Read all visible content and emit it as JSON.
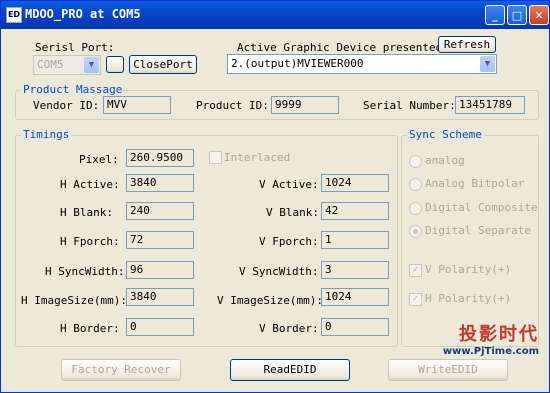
{
  "window": {
    "title": "MDOO_PRO at COM5",
    "icon_text": "ED"
  },
  "serial": {
    "label": "Serisl Port:",
    "value": "COM5",
    "close_button": "ClosePort"
  },
  "graphic": {
    "label": "Active Graphic Device presented",
    "refresh_button": "Refresh",
    "device": "2.(output)MVIEWER000"
  },
  "product": {
    "legend": "Product Massage",
    "vendor_label": "Vendor ID:",
    "vendor_value": "MVV",
    "product_label": "Product ID:",
    "product_value": "9999",
    "serial_label": "Serial Number:",
    "serial_value": "13451789"
  },
  "timings": {
    "legend": "Timings",
    "pixel_label": "Pixel:",
    "pixel_value": "260.9500",
    "interlaced_label": "Interlaced",
    "left": [
      {
        "label": "H Active:",
        "value": "3840"
      },
      {
        "label": "H Blank:",
        "value": "240"
      },
      {
        "label": "H Fporch:",
        "value": "72"
      },
      {
        "label": "H SyncWidth:",
        "value": "96"
      },
      {
        "label": "H ImageSize(mm):",
        "value": "3840"
      },
      {
        "label": "H Border:",
        "value": "0"
      }
    ],
    "right": [
      {
        "label": "V Active:",
        "value": "1024"
      },
      {
        "label": "V Blank:",
        "value": "42"
      },
      {
        "label": "V Fporch:",
        "value": "1"
      },
      {
        "label": "V SyncWidth:",
        "value": "3"
      },
      {
        "label": "V ImageSize(mm):",
        "value": "1024"
      },
      {
        "label": "V Border:",
        "value": "0"
      }
    ]
  },
  "sync": {
    "legend": "Sync Scheme",
    "options": [
      "analog",
      "Analog Bitpolar",
      "Digital Composite",
      "Digital Separate"
    ],
    "v_polarity": "V Polarity(+)",
    "h_polarity": "H Polarity(+)"
  },
  "buttons": {
    "factory": "Factory Recover",
    "read": "ReadEDID",
    "write": "WriteEDID"
  },
  "watermark": {
    "cn": "投影时代",
    "url": "www.PjTime.com"
  }
}
